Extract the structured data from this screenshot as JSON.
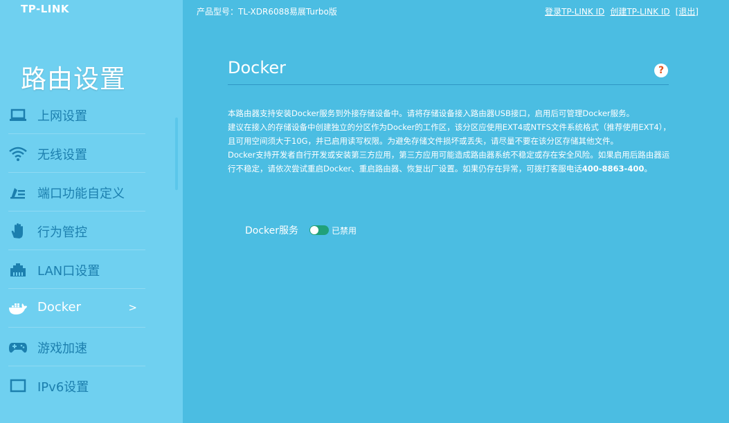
{
  "brand": {
    "logo_text": "TP-LINK"
  },
  "header": {
    "model": "产品型号：TL-XDR6088易展Turbo版",
    "links": [
      "登录TP-LINK ID",
      "创建TP-LINK ID",
      "[退出]"
    ]
  },
  "sidebar": {
    "title": "路由设置",
    "items": [
      {
        "label": "上网设置",
        "icon": "laptop-icon"
      },
      {
        "label": "无线设置",
        "icon": "wifi-icon"
      },
      {
        "label": "端口功能自定义",
        "icon": "port-custom-icon"
      },
      {
        "label": "行为管控",
        "icon": "hand-icon"
      },
      {
        "label": "LAN口设置",
        "icon": "lan-port-icon"
      },
      {
        "label": "Docker",
        "icon": "docker-whale-icon",
        "active": true,
        "arrow": ">"
      },
      {
        "label": "游戏加速",
        "icon": "gamepad-icon"
      },
      {
        "label": "IPv6设置",
        "icon": "ipv6-icon"
      }
    ]
  },
  "main": {
    "title": "Docker",
    "help_icon": "?",
    "description": [
      "本路由器支持安装Docker服务到外接存储设备中。请将存储设备接入路由器USB接口，启用后可管理Docker服务。",
      "建议在接入的存储设备中创建独立的分区作为Docker的工作区，该分区应使用EXT4或NTFS文件系统格式（推荐使用EXT4），且可用空间须大于10G，并已启用读写权限。为避免存储文件损坏或丢失，请尽量不要在该分区存储其他文件。",
      "Docker支持开发者自行开发或安装第三方应用，第三方应用可能造成路由器系统不稳定或存在安全风险。如果启用后路由器运行不稳定，请依次尝试重启Docker、重启路由器、恢复出厂设置。如果仍存在异常，可拨打客服电话"
    ],
    "hotline": "400-8863-400",
    "hotline_suffix": "。",
    "service_label": "Docker服务",
    "service_state": "已禁用"
  },
  "colors": {
    "sidebar_bg": "#6fd0f0",
    "main_bg": "#4bbde2",
    "nav_text": "#1c7fae",
    "toggle": "#21a179",
    "help": "#e0531e"
  }
}
